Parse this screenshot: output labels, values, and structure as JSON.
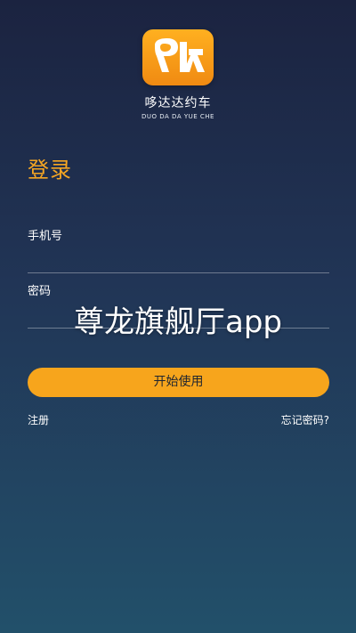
{
  "app": {
    "name": "哆达达约车",
    "name_en": "DUO DA DA YUE CHE"
  },
  "login": {
    "title": "登录",
    "phone_label": "手机号",
    "phone_value": "",
    "password_label": "密码",
    "password_value": "",
    "submit_label": "开始使用",
    "register_label": "注册",
    "forgot_label": "忘记密码?"
  },
  "overlay": {
    "watermark_text": "尊龙旗舰厅app"
  },
  "colors": {
    "accent": "#f5a623",
    "button": "#f7a51c",
    "background_top": "#1b2340",
    "background_bottom": "#22506a"
  },
  "icons": {
    "logo": "app-logo-icon"
  }
}
